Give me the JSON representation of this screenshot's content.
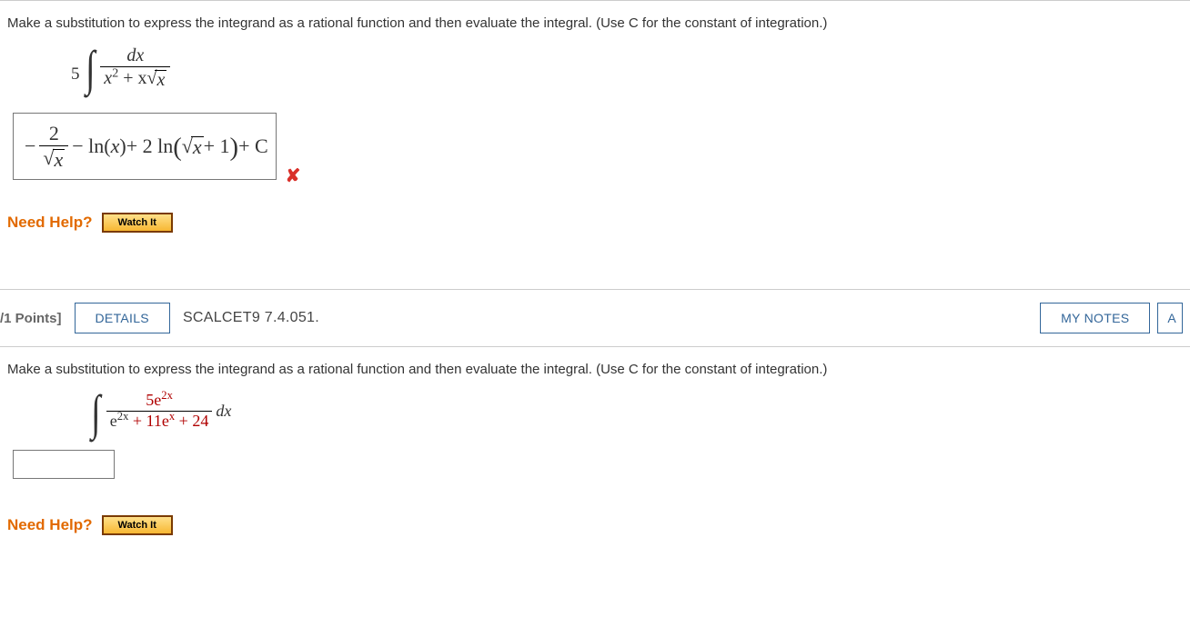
{
  "q1": {
    "prompt": "Make a substitution to express the integrand as a rational function and then evaluate the integral. (Use C for the constant of integration.)",
    "integral": {
      "coef": "5",
      "numerator": "dx",
      "den_x2": "x",
      "den_x2_exp": "2",
      "den_plus": " + x",
      "den_rad": "x"
    },
    "answer": {
      "frac_num": "2",
      "frac_den": "x",
      "t1": "− ln",
      "t1_arg": "x",
      "t2a": " + 2 ln",
      "t2_rad": "x",
      "t2_tail": " + 1",
      "tail": " + C"
    },
    "wrong_mark": "✘",
    "need_help": "Need Help?",
    "watch": "Watch It"
  },
  "bar": {
    "points": "/1 Points]",
    "details": "DETAILS",
    "ref": "SCALCET9 7.4.051.",
    "notes": "MY NOTES",
    "ask": "A"
  },
  "q2": {
    "prompt": "Make a substitution to express the integrand as a rational function and then evaluate the integral. (Use C for the constant of integration.)",
    "integral": {
      "num_coef": "5e",
      "num_exp": "2x",
      "den_a": "e",
      "den_a_exp": "2x",
      "den_mid": " + 11e",
      "den_mid_exp": "x",
      "den_tail": " + 24",
      "dx": " dx"
    },
    "need_help": "Need Help?",
    "watch": "Watch It"
  }
}
